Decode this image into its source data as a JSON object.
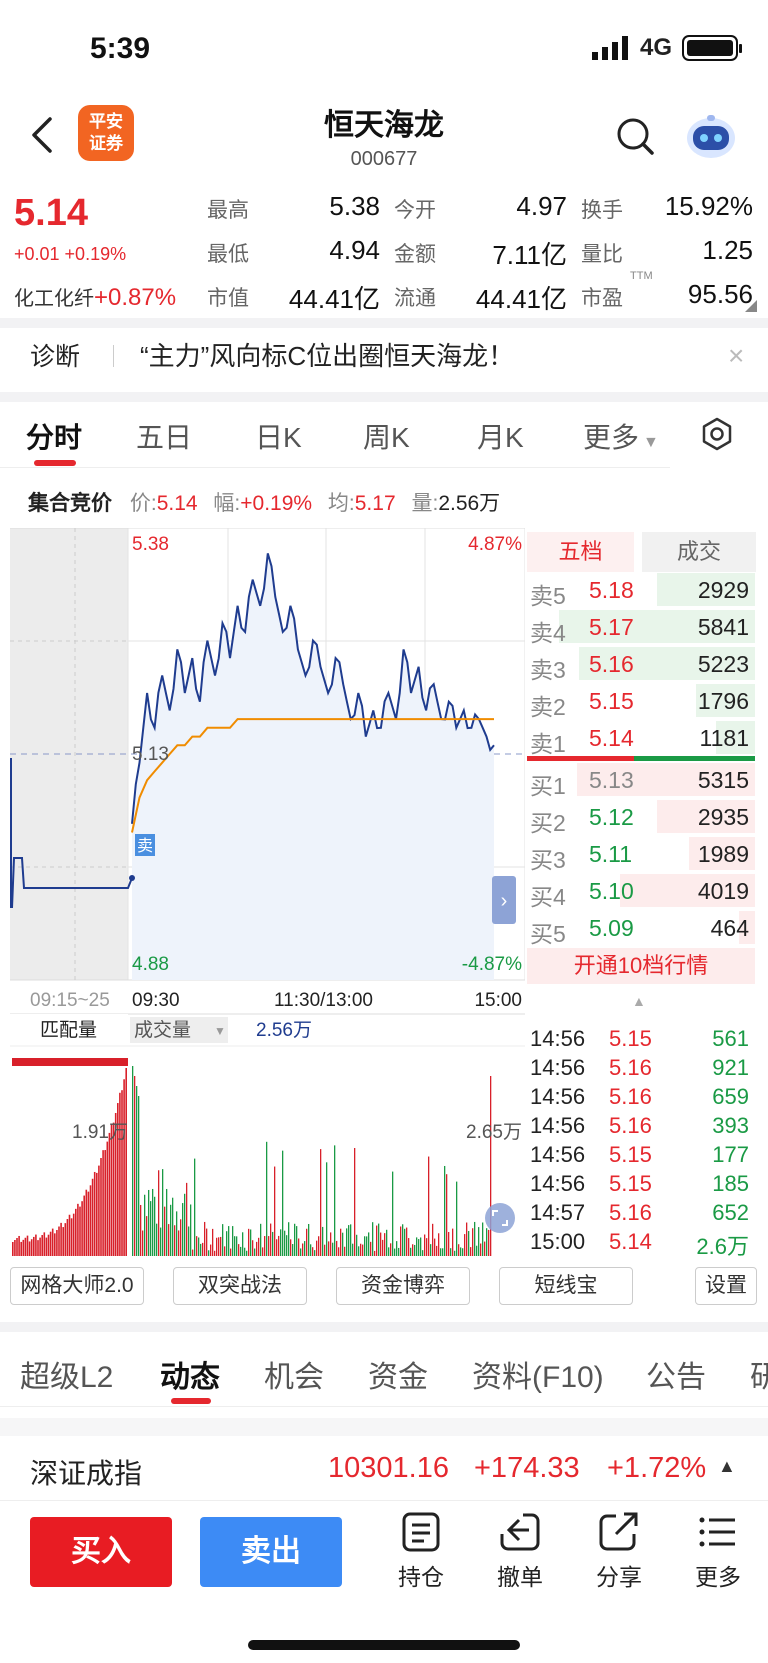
{
  "status": {
    "time": "5:39",
    "network": "4G"
  },
  "header": {
    "logo_line1": "平安",
    "logo_line2": "证券",
    "name": "恒天海龙",
    "code": "000677"
  },
  "quote": {
    "price": "5.14",
    "change": "+0.01 +0.19%",
    "sector_name": "化工化纤",
    "sector_change": "+0.87%",
    "fields": [
      {
        "label": "最高",
        "value": "5.38"
      },
      {
        "label": "今开",
        "value": "4.97"
      },
      {
        "label": "换手",
        "value": "15.92%"
      },
      {
        "label": "最低",
        "value": "4.94"
      },
      {
        "label": "金额",
        "value": "7.11亿"
      },
      {
        "label": "量比",
        "value": "1.25"
      },
      {
        "label": "市值",
        "value": "44.41亿"
      },
      {
        "label": "流通",
        "value": "44.41亿"
      },
      {
        "label": "市盈",
        "value": "95.56"
      }
    ],
    "ttm": "TTM"
  },
  "diagnosis": {
    "label": "诊断",
    "text": "“主力”风向标C位出圈恒天海龙！",
    "close": "×"
  },
  "chart_tabs": [
    "分时",
    "五日",
    "日K",
    "周K",
    "月K",
    "更多"
  ],
  "auction": {
    "label": "集合竞价",
    "price_k": "价:",
    "price_v": "5.14",
    "amp_k": "幅:",
    "amp_v": "+0.19%",
    "avg_k": "均:",
    "avg_v": "5.17",
    "vol_k": "量:",
    "vol_v": "2.56万"
  },
  "chart_labels": {
    "high_price": "5.38",
    "high_pct": "4.87%",
    "mid_price": "5.13",
    "low_price": "4.88",
    "low_pct": "-4.87%",
    "sell_marker": "卖",
    "time_auction": "09:15~25",
    "time_open": "09:30",
    "time_mid": "11:30/13:00",
    "time_close": "15:00",
    "match_label": "匹配量",
    "vol_label": "成交量",
    "vol_value": "2.56万",
    "left_vol_max": "1.91万",
    "right_vol_max": "2.65万"
  },
  "order_book": {
    "tab_levels": "五档",
    "tab_trades": "成交",
    "asks": [
      {
        "label": "卖5",
        "price": "5.18",
        "vol": "2929",
        "fill": 0.43
      },
      {
        "label": "卖4",
        "price": "5.17",
        "vol": "5841",
        "fill": 0.86
      },
      {
        "label": "卖3",
        "price": "5.16",
        "vol": "5223",
        "fill": 0.77
      },
      {
        "label": "卖2",
        "price": "5.15",
        "vol": "1796",
        "fill": 0.26
      },
      {
        "label": "卖1",
        "price": "5.14",
        "vol": "1181",
        "fill": 0.17
      }
    ],
    "bids": [
      {
        "label": "买1",
        "price": "5.13",
        "vol": "5315",
        "fill": 0.78
      },
      {
        "label": "买2",
        "price": "5.12",
        "vol": "2935",
        "fill": 0.43
      },
      {
        "label": "买3",
        "price": "5.11",
        "vol": "1989",
        "fill": 0.29
      },
      {
        "label": "买4",
        "price": "5.10",
        "vol": "4019",
        "fill": 0.59
      },
      {
        "label": "买5",
        "price": "5.09",
        "vol": "464",
        "fill": 0.07
      }
    ],
    "upgrade": "开通10档行情"
  },
  "trades": [
    {
      "time": "14:56",
      "price": "5.15",
      "vol": "561"
    },
    {
      "time": "14:56",
      "price": "5.16",
      "vol": "921"
    },
    {
      "time": "14:56",
      "price": "5.16",
      "vol": "659"
    },
    {
      "time": "14:56",
      "price": "5.16",
      "vol": "393"
    },
    {
      "time": "14:56",
      "price": "5.15",
      "vol": "177"
    },
    {
      "time": "14:56",
      "price": "5.15",
      "vol": "185"
    },
    {
      "time": "14:57",
      "price": "5.16",
      "vol": "652"
    },
    {
      "time": "15:00",
      "price": "5.14",
      "vol": "2.6万"
    }
  ],
  "tools": [
    "网格大师2.0",
    "双突战法",
    "资金博弈",
    "短线宝",
    "设置"
  ],
  "lower_tabs": [
    "超级L2",
    "动态",
    "机会",
    "资金",
    "资料(F10)",
    "公告",
    "研"
  ],
  "index": {
    "name": "深证成指",
    "value": "10301.16",
    "change": "+174.33",
    "pct": "+1.72%"
  },
  "actions": {
    "buy": "买入",
    "sell": "卖出",
    "hold": "持仓",
    "cancel": "撤单",
    "share": "分享",
    "more": "更多"
  },
  "colors": {
    "up": "#e5282e",
    "down": "#1a9a45",
    "price_line": "#1f3c8f",
    "avg_line": "#f08c00",
    "buy_button": "#e81c23",
    "sell_button": "#3d8bf5"
  },
  "chart_data": {
    "type": "line",
    "ylim": [
      4.88,
      5.38
    ],
    "reference_price": 5.13,
    "price": [
      5.05,
      5.12,
      5.2,
      5.16,
      5.22,
      5.18,
      5.25,
      5.2,
      5.24,
      5.19,
      5.26,
      5.22,
      5.28,
      5.24,
      5.3,
      5.27,
      5.33,
      5.3,
      5.36,
      5.31,
      5.27,
      5.3,
      5.25,
      5.22,
      5.26,
      5.23,
      5.2,
      5.24,
      5.21,
      5.17,
      5.2,
      5.15,
      5.18,
      5.16,
      5.2,
      5.17,
      5.25,
      5.2,
      5.23,
      5.18,
      5.21,
      5.17,
      5.19,
      5.16,
      5.18,
      5.16,
      5.17,
      5.15,
      5.14
    ],
    "average": [
      5.04,
      5.08,
      5.1,
      5.11,
      5.12,
      5.13,
      5.14,
      5.14,
      5.15,
      5.15,
      5.16,
      5.16,
      5.16,
      5.16,
      5.17,
      5.17,
      5.17,
      5.17,
      5.17,
      5.17,
      5.17,
      5.17,
      5.17,
      5.17,
      5.17,
      5.17,
      5.17,
      5.17,
      5.17,
      5.17,
      5.17,
      5.17,
      5.17,
      5.17,
      5.17,
      5.17,
      5.17,
      5.17,
      5.17,
      5.17,
      5.17,
      5.17,
      5.17,
      5.17,
      5.17,
      5.17,
      5.17,
      5.17,
      5.17
    ]
  }
}
